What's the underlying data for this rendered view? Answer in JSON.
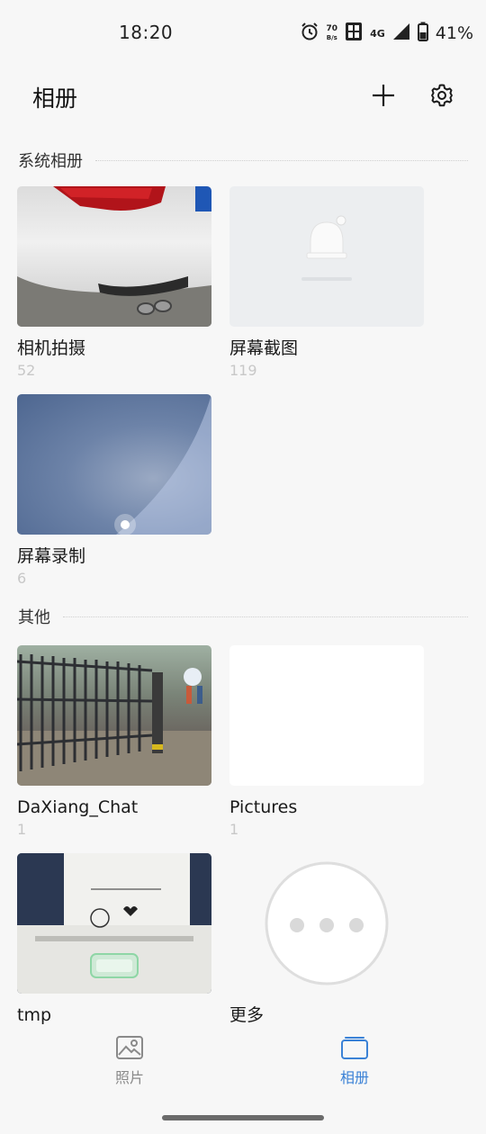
{
  "status_bar": {
    "time": "18:20",
    "net_speed_value": "70",
    "net_speed_unit": "B/s",
    "signal_type": "4G",
    "battery": "41%"
  },
  "header": {
    "title": "相册",
    "add_icon": "plus-icon",
    "settings_icon": "gear-icon"
  },
  "sections": {
    "system": {
      "title": "系统相册",
      "albums": [
        {
          "name": "相机拍摄",
          "count": "52"
        },
        {
          "name": "屏幕截图",
          "count": "119"
        },
        {
          "name": "屏幕录制",
          "count": "6"
        }
      ]
    },
    "other": {
      "title": "其他",
      "albums": [
        {
          "name": "DaXiang_Chat",
          "count": "1"
        },
        {
          "name": "Pictures",
          "count": "1"
        },
        {
          "name": "tmp",
          "count": ""
        },
        {
          "name": "更多",
          "count": ""
        }
      ]
    }
  },
  "tab_bar": {
    "tabs": [
      {
        "label": "照片",
        "icon": "image-icon",
        "active": false
      },
      {
        "label": "相册",
        "icon": "albums-icon",
        "active": true
      }
    ],
    "active_color": "#3b82d6",
    "inactive_color": "#8a8a8a"
  },
  "colors": {
    "background": "#f7f7f7",
    "count_text": "#c8c8c8"
  }
}
